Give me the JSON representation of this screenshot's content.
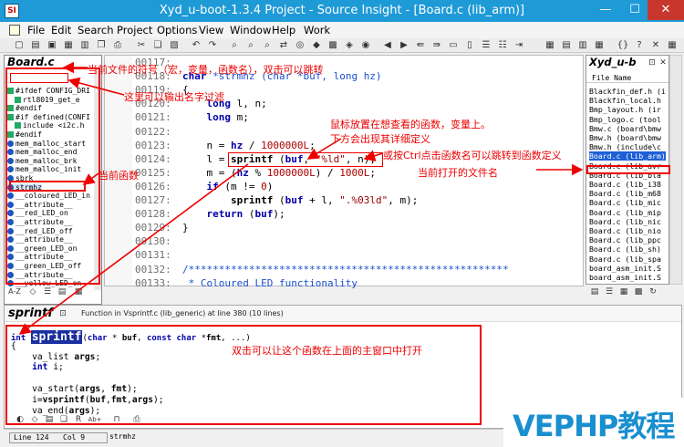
{
  "window": {
    "title": "Xyd_u-boot-1.3.4 Project - Source Insight - [Board.c (lib_arm)]",
    "minimize": "—",
    "maximize": "☐",
    "close": "✕",
    "app_icon": "SI"
  },
  "menu": {
    "items": [
      "File",
      "Edit",
      "Search",
      "Project",
      "Options",
      "View",
      "Window",
      "Help",
      "Work"
    ]
  },
  "symbol_panel": {
    "title": "Board.c",
    "filter_value": "",
    "items": [
      {
        "icon": "directive",
        "label": "#ifdef CONFIG_DRI"
      },
      {
        "icon": "include",
        "label": "rtl8019_get_e"
      },
      {
        "icon": "directive",
        "label": "#endif"
      },
      {
        "icon": "directive",
        "label": "#if defined(CONFI"
      },
      {
        "icon": "include",
        "label": "include <i2c.h"
      },
      {
        "icon": "directive",
        "label": "#endif"
      },
      {
        "icon": "function",
        "label": "mem_malloc_start"
      },
      {
        "icon": "function",
        "label": "mem_malloc_end"
      },
      {
        "icon": "function",
        "label": "mem_malloc_brk"
      },
      {
        "icon": "function",
        "label": "mem_malloc_init"
      },
      {
        "icon": "function",
        "label": "sbrk"
      },
      {
        "icon": "function",
        "label": "strmhz"
      },
      {
        "icon": "function",
        "label": "__coloured_LED_in"
      },
      {
        "icon": "function",
        "label": "__attribute__"
      },
      {
        "icon": "function",
        "label": "__red_LED_on"
      },
      {
        "icon": "function",
        "label": "__attribute__"
      },
      {
        "icon": "function",
        "label": "__red_LED_off"
      },
      {
        "icon": "function",
        "label": "__attribute__"
      },
      {
        "icon": "function",
        "label": "__green_LED_on"
      },
      {
        "icon": "function",
        "label": "__attribute__"
      },
      {
        "icon": "function",
        "label": "__green_LED_off"
      },
      {
        "icon": "function",
        "label": "__attribute__"
      },
      {
        "icon": "function",
        "label": "__yellow_LED_on"
      }
    ],
    "bottom_label": "A-Z"
  },
  "editor": {
    "lines": [
      {
        "num": "00117:",
        "text": ""
      },
      {
        "num": "00118:",
        "text": "char *strmhz (char *buf, long hz)"
      },
      {
        "num": "00119:",
        "text": "{"
      },
      {
        "num": "00120:",
        "text": "    long l, n;"
      },
      {
        "num": "00121:",
        "text": "    long m;"
      },
      {
        "num": "00122:",
        "text": ""
      },
      {
        "num": "00123:",
        "text": "    n = hz / 1000000L;"
      },
      {
        "num": "00124:",
        "text": "    l = sprintf (buf, \"%ld\", n);"
      },
      {
        "num": "00125:",
        "text": "    m = (hz % 1000000L) / 1000L;"
      },
      {
        "num": "00126:",
        "text": "    if (m != 0)"
      },
      {
        "num": "00127:",
        "text": "        sprintf (buf + l, \".%03ld\", m);"
      },
      {
        "num": "00128:",
        "text": "    return (buf);"
      },
      {
        "num": "00129:",
        "text": "}"
      },
      {
        "num": "00130:",
        "text": ""
      },
      {
        "num": "00131:",
        "text": ""
      },
      {
        "num": "00132:",
        "text": "/*****************************************************"
      },
      {
        "num": "00133:",
        "text": " * Coloured LED functionality"
      }
    ]
  },
  "file_panel": {
    "title": "Xyd_u-b",
    "header": "File Name",
    "items": [
      "Blackfin_def.h (i",
      "Blackfin_local.h",
      "Bmp_layout.h (ir",
      "Bmp_logo.c (tool",
      "Bmw.c (board\\bmw",
      "Bmw.h (board\\bmw",
      "Bmw.h (include\\c",
      "Board.c (lib_arm)",
      "Board.c (lib_avr",
      "Board.c (lib_bla",
      "Board.c (lib_i38",
      "Board.c (lib_m68",
      "Board.c (lib_mic",
      "Board.c (lib_mip",
      "Board.c (lib_nic",
      "Board.c (lib_nio",
      "Board.c (lib_ppc",
      "Board.c (lib_sh)",
      "Board.c (lib_spa",
      "board_asm_init.S",
      "board_asm_init.S"
    ]
  },
  "context": {
    "title": "sprintf",
    "info": "Function in Vsprintf.c (lib_generic) at line 380 (10 lines)",
    "lines": [
      "int sprintf(char * buf, const char *fmt, ...)",
      "{",
      "    va_list args;",
      "    int i;",
      "",
      "    va_start(args, fmt);",
      "    i=vsprintf(buf,fmt,args);",
      "    va_end(args);"
    ]
  },
  "status": {
    "line": "Line 124",
    "col": "Col 9",
    "symbol": "strmhz"
  },
  "annotations": {
    "a1": "当前文件的符号（宏，变量，函数名），双击可以跳转",
    "a2": "这里可以输出名字过滤",
    "a3": "鼠标放置在想查看的函数，变量上。",
    "a4": "下方会出现其详细定义",
    "a5": "或按Ctrl点击函数名可以跳转到函数定义",
    "a6": "当前打开的文件名",
    "a7": "当前函数",
    "a8": "双击可以让这个函数在上面的主窗口中打开"
  },
  "watermark": "VEPHP教程",
  "colors": {
    "accent": "#1e9ad6",
    "annotation": "#e00000",
    "keyword": "#0000cc",
    "string": "#990000",
    "comment": "#0000ff"
  }
}
